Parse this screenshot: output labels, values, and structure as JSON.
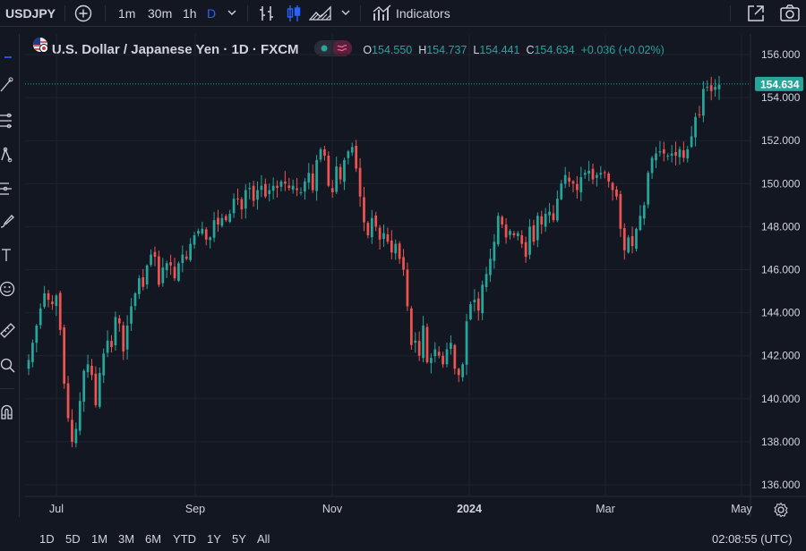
{
  "toolbar": {
    "symbol": "USDJPY",
    "intervals": [
      "1m",
      "30m",
      "1h",
      "D"
    ],
    "indicators_label": "Indicators"
  },
  "legend": {
    "title": "U.S. Dollar / Japanese Yen · 1D · FXCM",
    "open_key": "O",
    "open": "154.550",
    "high_key": "H",
    "high": "154.737",
    "low_key": "L",
    "low": "154.441",
    "close_key": "C",
    "close": "154.634",
    "change": "+0.036 (+0.02%)"
  },
  "price_axis": {
    "labels": [
      "156.000",
      "154.000",
      "152.000",
      "150.000",
      "148.000",
      "146.000",
      "144.000",
      "142.000",
      "140.000",
      "138.000",
      "136.000"
    ],
    "last_price": "154.634"
  },
  "time_axis": {
    "labels": [
      "Jul",
      "Sep",
      "Nov",
      "2024",
      "Mar",
      "May"
    ]
  },
  "bottom": {
    "ranges": [
      "1D",
      "5D",
      "1M",
      "3M",
      "6M",
      "YTD",
      "1Y",
      "5Y",
      "All"
    ],
    "clock": "02:08:55 (UTC)"
  },
  "colors": {
    "up": "#26a69a",
    "down": "#ef5350",
    "background": "#131722",
    "grid": "#1f2330",
    "last_price_badge": "#26a69a"
  },
  "chart_data": {
    "type": "candlestick",
    "symbol": "USDJPY",
    "interval": "1D",
    "ylim": [
      136,
      157
    ],
    "x_ticks": [
      "Jul",
      "Sep",
      "Nov",
      "2024",
      "Mar",
      "May"
    ],
    "close_path": [
      141.8,
      142.6,
      143.4,
      144.2,
      144.9,
      144.6,
      144.4,
      144.8,
      143.2,
      140.7,
      139.1,
      138.0,
      138.6,
      139.9,
      141.3,
      141.6,
      141.1,
      139.7,
      141.2,
      142.1,
      142.7,
      142.4,
      143.8,
      143.5,
      142.2,
      143.4,
      144.3,
      144.9,
      145.6,
      145.2,
      146.2,
      146.7,
      146.6,
      145.3,
      146.1,
      146.3,
      146.2,
      145.6,
      146.3,
      146.7,
      146.5,
      147.2,
      147.6,
      147.8,
      147.9,
      147.4,
      147.5,
      148.3,
      148.1,
      148.4,
      148.3,
      148.6,
      149.3,
      149.3,
      148.8,
      149.7,
      149.8,
      149.2,
      149.7,
      149.9,
      149.4,
      149.7,
      149.9,
      149.8,
      150.1,
      150.0,
      149.8,
      149.9,
      149.7,
      149.6,
      150.1,
      150.5,
      149.7,
      151.1,
      151.6,
      151.3,
      149.9,
      149.6,
      150.8,
      150.2,
      151.1,
      151.5,
      151.7,
      150.7,
      149.4,
      148.2,
      147.6,
      148.4,
      148.0,
      147.4,
      147.7,
      147.3,
      146.8,
      147.2,
      146.5,
      146.0,
      144.3,
      142.5,
      142.7,
      142.0,
      143.4,
      141.7,
      141.9,
      142.3,
      142.0,
      141.6,
      142.3,
      142.6,
      141.4,
      141.1,
      141.6,
      143.6,
      144.4,
      144.6,
      144.1,
      145.3,
      145.8,
      146.5,
      147.3,
      148.5,
      148.1,
      147.5,
      147.8,
      147.6,
      147.7,
      147.2,
      146.6,
      148.0,
      147.3,
      148.5,
      148.1,
      148.6,
      148.7,
      148.3,
      149.3,
      150.0,
      150.4,
      150.1,
      150.0,
      149.7,
      150.3,
      150.5,
      150.6,
      150.2,
      150.4,
      150.5,
      150.5,
      150.1,
      149.7,
      149.4,
      147.9,
      146.9,
      147.5,
      147.1,
      147.9,
      148.5,
      149.0,
      150.5,
      151.2,
      151.4,
      151.5,
      151.4,
      151.3,
      151.4,
      151.3,
      151.6,
      151.2,
      151.6,
      152.2,
      153.1,
      153.2,
      154.4,
      154.5,
      154.3,
      154.5,
      154.6
    ]
  }
}
